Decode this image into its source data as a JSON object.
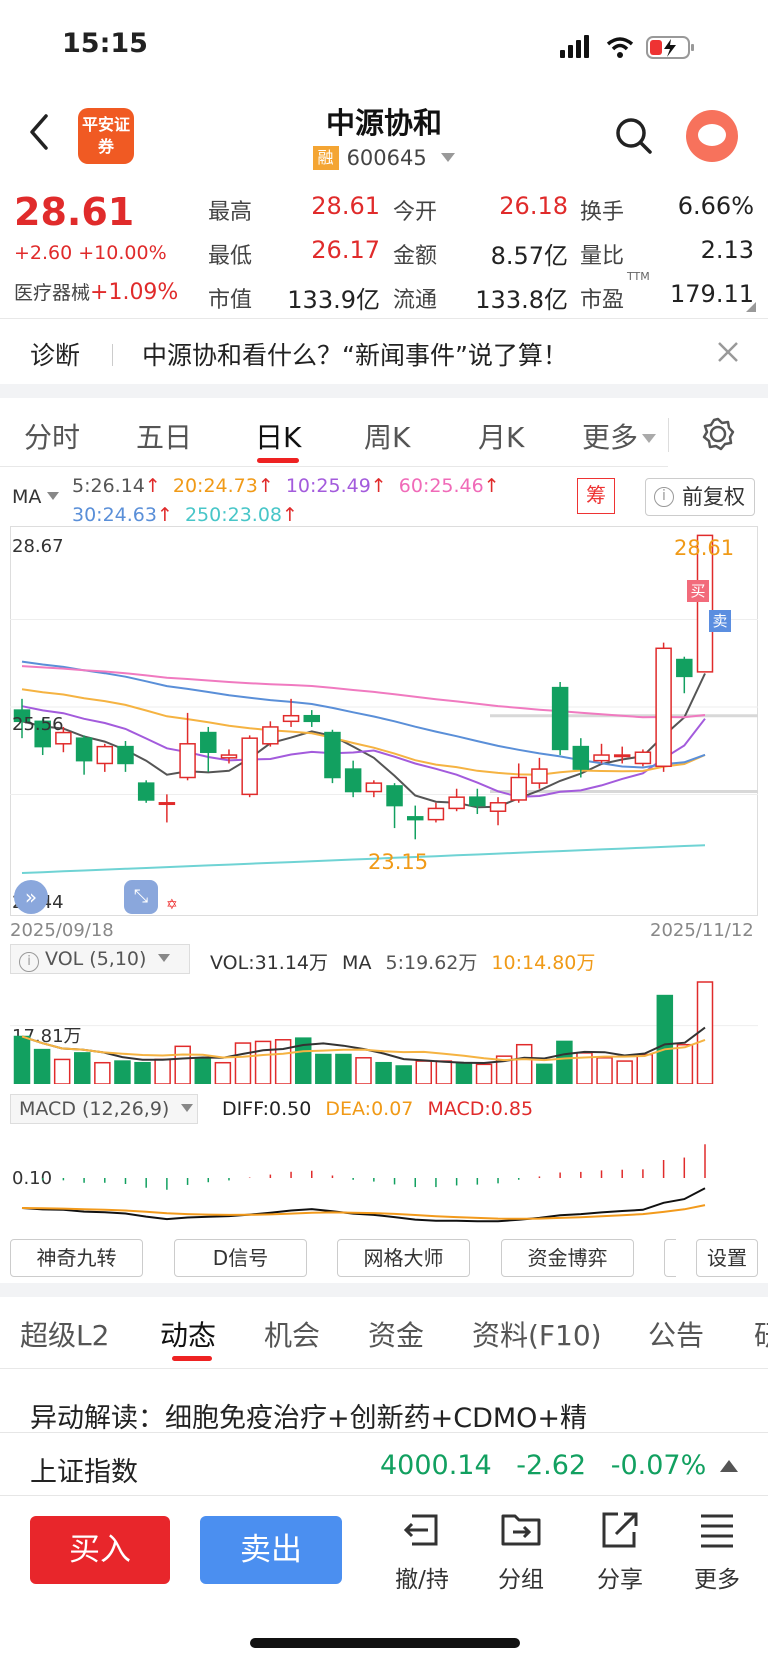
{
  "status": {
    "time": "15:15"
  },
  "header": {
    "logo_text": "平安证券",
    "title": "中源协和",
    "badge": "融",
    "code": "600645",
    "icons": [
      "back-icon",
      "search-icon",
      "avatar-icon"
    ]
  },
  "quote": {
    "price": "28.61",
    "change": "+2.60 +10.00%",
    "sector_name": "医疗器械",
    "sector_change": "+1.09%",
    "high_label": "最高",
    "high": "28.61",
    "low_label": "最低",
    "low": "26.17",
    "mktcap_label": "市值",
    "mktcap": "133.9亿",
    "open_label": "今开",
    "open": "26.18",
    "amount_label": "金额",
    "amount": "8.57亿",
    "float_label": "流通",
    "float": "133.8亿",
    "turnover_label": "换手",
    "turnover": "6.66%",
    "volratio_label": "量比",
    "volratio": "2.13",
    "pe_label": "市盈",
    "pe_sup": "TTM",
    "pe": "179.11"
  },
  "diagnosis": {
    "label": "诊断",
    "text": "中源协和看什么？“新闻事件”说了算！"
  },
  "period_tabs": [
    "分时",
    "五日",
    "日K",
    "周K",
    "月K",
    "更多"
  ],
  "active_period": "日K",
  "ma": {
    "label": "MA",
    "ma5": "5:26.14",
    "ma20": "20:24.73",
    "ma10": "10:25.49",
    "ma60": "60:25.46",
    "ma30": "30:24.63",
    "ma250": "250:23.08",
    "arrow": "↑",
    "chou_label": "筹",
    "fq_label": "前复权"
  },
  "colors": {
    "up": "#e02b2b",
    "down": "#12a060",
    "ma5": "#555555",
    "ma10": "#a35bdc",
    "ma20": "#f5b342",
    "ma30": "#5a8fd8",
    "ma60": "#f07ac0",
    "ma250": "#6fd3d4"
  },
  "chart_data": {
    "type": "candlestick",
    "y_top_label": "28.67",
    "y_mid_label": "25.56",
    "y_bot_label": "22.44",
    "ylim": [
      22.44,
      28.67
    ],
    "start_date": "2025/09/18",
    "end_date": "2025/11/12",
    "high_marker": "28.61",
    "low_marker": "23.15",
    "buy_marker": "买",
    "sell_marker": "卖",
    "candles": [
      [
        25.5,
        25.3,
        25.7,
        25.0
      ],
      [
        25.3,
        24.85,
        25.35,
        24.7
      ],
      [
        24.9,
        25.1,
        25.2,
        24.75
      ],
      [
        25.0,
        24.6,
        25.05,
        24.35
      ],
      [
        24.55,
        24.85,
        24.9,
        24.4
      ],
      [
        24.85,
        24.55,
        24.95,
        24.4
      ],
      [
        24.2,
        23.9,
        24.25,
        23.85
      ],
      [
        23.85,
        23.85,
        24.0,
        23.5
      ],
      [
        24.3,
        24.9,
        25.45,
        24.25
      ],
      [
        25.1,
        24.75,
        25.2,
        24.4
      ],
      [
        24.65,
        24.7,
        24.8,
        24.55
      ],
      [
        24.0,
        25.0,
        25.05,
        23.95
      ],
      [
        24.9,
        25.2,
        25.3,
        24.85
      ],
      [
        25.3,
        25.4,
        25.7,
        25.2
      ],
      [
        25.4,
        25.3,
        25.5,
        25.2
      ],
      [
        25.1,
        24.3,
        25.15,
        24.2
      ],
      [
        24.45,
        24.05,
        24.6,
        23.95
      ],
      [
        24.05,
        24.2,
        24.25,
        23.95
      ],
      [
        24.15,
        23.8,
        24.2,
        23.4
      ],
      [
        23.6,
        23.55,
        23.8,
        23.2
      ],
      [
        23.55,
        23.75,
        23.85,
        23.5
      ],
      [
        23.75,
        23.95,
        24.1,
        23.7
      ],
      [
        23.95,
        23.8,
        24.1,
        23.65
      ],
      [
        23.7,
        23.85,
        23.95,
        23.45
      ],
      [
        23.9,
        24.3,
        24.55,
        23.85
      ],
      [
        24.2,
        24.45,
        24.65,
        24.1
      ],
      [
        25.9,
        24.8,
        26.0,
        24.7
      ],
      [
        24.85,
        24.45,
        25.0,
        24.3
      ],
      [
        24.6,
        24.7,
        24.9,
        24.55
      ],
      [
        24.7,
        24.7,
        24.85,
        24.55
      ],
      [
        24.55,
        24.75,
        24.8,
        24.5
      ],
      [
        24.5,
        26.6,
        26.7,
        24.4
      ],
      [
        26.4,
        26.1,
        26.45,
        25.8
      ],
      [
        26.18,
        28.61,
        28.61,
        26.17
      ]
    ],
    "volume": {
      "label": "VOL (5,10)",
      "vol": "VOL:31.14万",
      "ma_label": "MA",
      "ma5": "5:19.62万",
      "ma10": "10:14.80万",
      "axis_label": "17.81万",
      "max": 31.14,
      "values": [
        14.5,
        10.5,
        7.5,
        9.5,
        6.5,
        7.0,
        6.5,
        7.5,
        11.5,
        8.0,
        6.5,
        12.5,
        13.0,
        13.5,
        14.0,
        9.0,
        9.0,
        8.0,
        6.5,
        5.5,
        7.0,
        7.0,
        6.5,
        6.0,
        8.5,
        12.0,
        6.0,
        13.0,
        9.5,
        8.0,
        7.0,
        9.0,
        27.0,
        12.0,
        31.14
      ]
    },
    "macd": {
      "label": "MACD (12,26,9)",
      "diff": "DIFF:0.50",
      "dea": "DEA:0.07",
      "macd": "MACD:0.85",
      "axis_label": "0.10"
    }
  },
  "tool_buttons": [
    "神奇九转",
    "D信号",
    "网格大师",
    "资金博弈",
    "设置"
  ],
  "section_tabs": [
    "超级L2",
    "动态",
    "机会",
    "资金",
    "资料(F10)",
    "公告"
  ],
  "active_section": "动态",
  "news": {
    "text": "异动解读：细胞免疫治疗+创新药+CDMO+精"
  },
  "index_bar": {
    "name": "上证指数",
    "value": "4000.14",
    "change": "-2.62",
    "pct": "-0.07%"
  },
  "bottom": {
    "buy": "买入",
    "sell": "卖出",
    "items": [
      {
        "label": "撤/持",
        "icon": "withdraw-icon"
      },
      {
        "label": "分组",
        "icon": "folder-icon"
      },
      {
        "label": "分享",
        "icon": "share-icon"
      },
      {
        "label": "更多",
        "icon": "menu-icon"
      }
    ]
  }
}
